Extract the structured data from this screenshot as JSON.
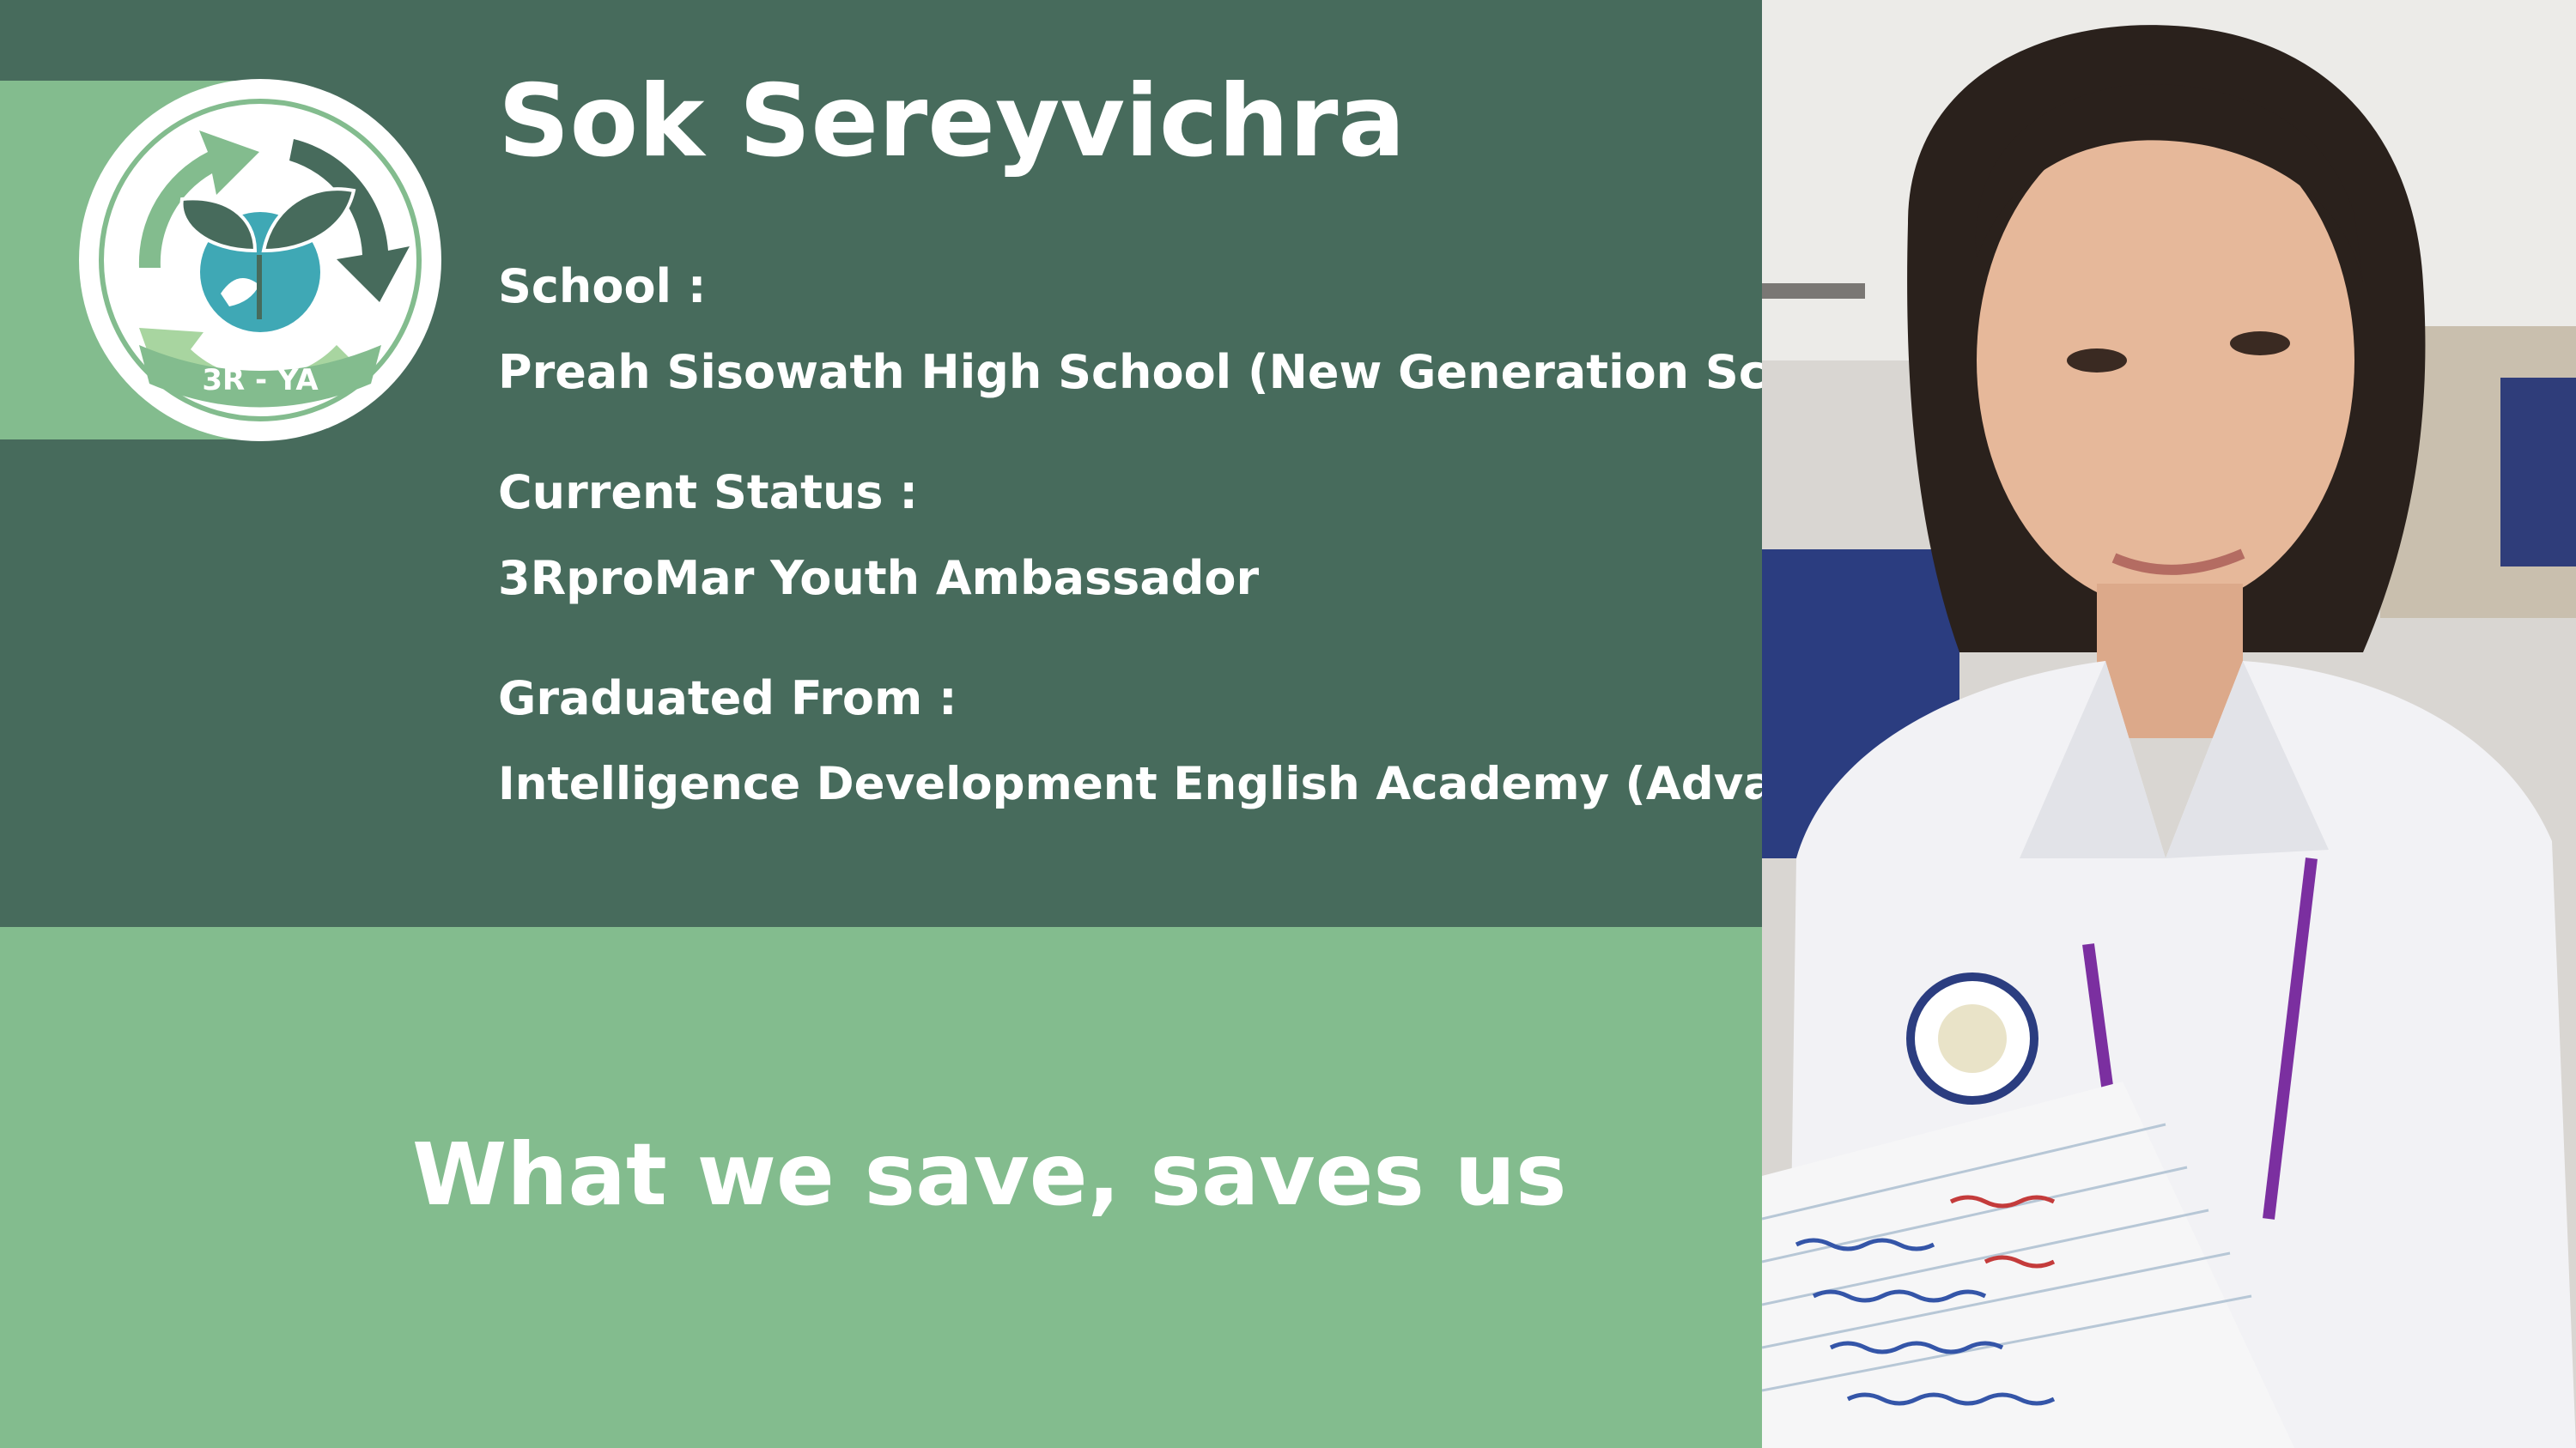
{
  "profile": {
    "name": "Sok Sereyvichra",
    "school_label": "School :",
    "school_value": "Preah Sisowath High School (New Generation School)",
    "status_label": "Current Status :",
    "status_value": "3RproMar Youth Ambassador",
    "graduated_label": "Graduated From :",
    "graduated_value": "Intelligence Development English Academy (Advanced)"
  },
  "slogan": "What we save, saves us",
  "logo": {
    "text": "3R - YA"
  },
  "colors": {
    "dark_green": "#476b5c",
    "light_green": "#83bc8e",
    "text": "#ffffff"
  }
}
